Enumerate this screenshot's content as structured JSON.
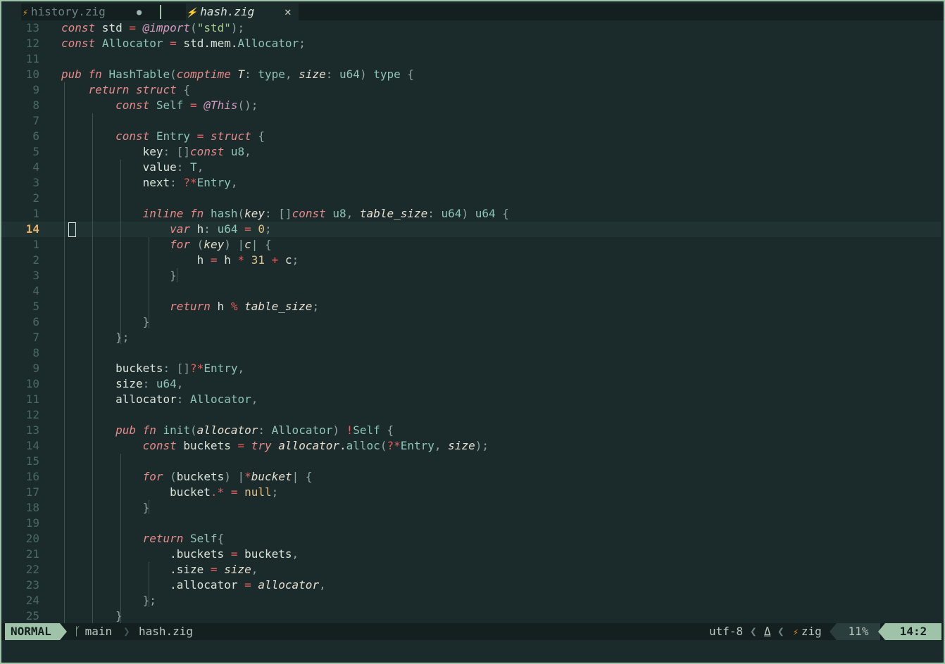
{
  "tabs": [
    {
      "name": "history.zig",
      "modified_indicator": "●",
      "icon": "zig-icon"
    },
    {
      "name": "hash.zig",
      "close_glyph": "✕",
      "icon": "zig-icon",
      "active": true
    }
  ],
  "editor": {
    "cursor_line": 14,
    "lines": [
      {
        "n": "13",
        "html": "<span class=\"kw\">const</span> std <span class=\"op\">=</span> <span class=\"bi\">@import</span><span class=\"pu\">(</span><span class=\"st\">\"std\"</span><span class=\"pu\">);</span>"
      },
      {
        "n": "12",
        "html": "<span class=\"kw\">const</span> <span class=\"ty\">Allocator</span> <span class=\"op\">=</span> std.mem.<span class=\"ty\">Allocator</span><span class=\"pu\">;</span>"
      },
      {
        "n": "11",
        "html": ""
      },
      {
        "n": "10",
        "html": "<span class=\"kw\">pub fn</span> <span class=\"ty\">HashTable</span><span class=\"pu\">(</span><span class=\"kw\">comptime</span> <span class=\"it\">T</span><span class=\"pu\">:</span> <span class=\"ty\">type</span><span class=\"pu\">,</span> <span class=\"it\">size</span><span class=\"pu\">:</span> <span class=\"ty\">u64</span><span class=\"pu\">)</span> <span class=\"ty\">type</span> <span class=\"pu\">{</span>"
      },
      {
        "n": "9",
        "html": "    <span class=\"kw\">return struct</span> <span class=\"pu\">{</span>"
      },
      {
        "n": "8",
        "html": "        <span class=\"kw\">const</span> <span class=\"ty\">Self</span> <span class=\"op\">=</span> <span class=\"bi\">@This</span><span class=\"pu\">();</span>"
      },
      {
        "n": "7",
        "html": ""
      },
      {
        "n": "6",
        "html": "        <span class=\"kw\">const</span> <span class=\"ty\">Entry</span> <span class=\"op\">=</span> <span class=\"kw\">struct</span> <span class=\"pu\">{</span>"
      },
      {
        "n": "5",
        "html": "            key<span class=\"pu\">:</span> <span class=\"pu\">[]</span><span class=\"kw\">const</span> <span class=\"ty\">u8</span><span class=\"pu\">,</span>"
      },
      {
        "n": "4",
        "html": "            value<span class=\"pu\">:</span> <span class=\"ty\">T</span><span class=\"pu\">,</span>"
      },
      {
        "n": "3",
        "html": "            next<span class=\"pu\">:</span> <span class=\"op\">?*</span><span class=\"ty\">Entry</span><span class=\"pu\">,</span>"
      },
      {
        "n": "2",
        "html": ""
      },
      {
        "n": "1",
        "html": "            <span class=\"kw\">inline fn</span> <span class=\"ty\">hash</span><span class=\"pu\">(</span><span class=\"it\">key</span><span class=\"pu\">:</span> <span class=\"pu\">[]</span><span class=\"kw\">const</span> <span class=\"ty\">u8</span><span class=\"pu\">,</span> <span class=\"it\">table_size</span><span class=\"pu\">:</span> <span class=\"ty\">u64</span><span class=\"pu\">)</span> <span class=\"ty\">u64</span> <span class=\"pu\">{</span>"
      },
      {
        "n": "14",
        "html": "                <span class=\"kw\">var</span> h<span class=\"pu\">:</span> <span class=\"ty\">u64</span> <span class=\"op\">=</span> <span class=\"nu\">0</span><span class=\"pu\">;</span>",
        "current": true
      },
      {
        "n": "1",
        "html": "                <span class=\"kw\">for</span> <span class=\"pu\">(</span><span class=\"it\">key</span><span class=\"pu\">)</span> <span class=\"pu\">|</span><span class=\"it\">c</span><span class=\"pu\">|</span> <span class=\"pu\">{</span>"
      },
      {
        "n": "2",
        "html": "                    h <span class=\"op\">=</span> h <span class=\"op\">*</span> <span class=\"nu\">31</span> <span class=\"op\">+</span> c<span class=\"pu\">;</span>"
      },
      {
        "n": "3",
        "html": "                <span class=\"pu\">}</span>"
      },
      {
        "n": "4",
        "html": ""
      },
      {
        "n": "5",
        "html": "                <span class=\"kw\">return</span> h <span class=\"op\">%</span> <span class=\"it\">table_size</span><span class=\"pu\">;</span>"
      },
      {
        "n": "6",
        "html": "            <span class=\"pu\">}</span>"
      },
      {
        "n": "7",
        "html": "        <span class=\"pu\">};</span>"
      },
      {
        "n": "8",
        "html": ""
      },
      {
        "n": "9",
        "html": "        buckets<span class=\"pu\">:</span> <span class=\"pu\">[]</span><span class=\"op\">?*</span><span class=\"ty\">Entry</span><span class=\"pu\">,</span>"
      },
      {
        "n": "10",
        "html": "        size<span class=\"pu\">:</span> <span class=\"ty\">u64</span><span class=\"pu\">,</span>"
      },
      {
        "n": "11",
        "html": "        allocator<span class=\"pu\">:</span> <span class=\"ty\">Allocator</span><span class=\"pu\">,</span>"
      },
      {
        "n": "12",
        "html": ""
      },
      {
        "n": "13",
        "html": "        <span class=\"kw\">pub fn</span> <span class=\"ty\">init</span><span class=\"pu\">(</span><span class=\"it\">allocator</span><span class=\"pu\">:</span> <span class=\"ty\">Allocator</span><span class=\"pu\">)</span> <span class=\"op\">!</span><span class=\"ty\">Self</span> <span class=\"pu\">{</span>"
      },
      {
        "n": "14",
        "html": "            <span class=\"kw\">const</span> buckets <span class=\"op\">=</span> <span class=\"kw\">try</span> <span class=\"it\">allocator</span>.<span class=\"ty\">alloc</span><span class=\"pu\">(</span><span class=\"op\">?*</span><span class=\"ty\">Entry</span><span class=\"pu\">,</span> <span class=\"it\">size</span><span class=\"pu\">);</span>"
      },
      {
        "n": "15",
        "html": ""
      },
      {
        "n": "16",
        "html": "            <span class=\"kw\">for</span> <span class=\"pu\">(</span>buckets<span class=\"pu\">)</span> <span class=\"pu\">|</span><span class=\"op\">*</span><span class=\"it\">bucket</span><span class=\"pu\">|</span> <span class=\"pu\">{</span>"
      },
      {
        "n": "17",
        "html": "                bucket<span class=\"op\">.*</span> <span class=\"op\">=</span> <span class=\"nu\">null</span><span class=\"pu\">;</span>"
      },
      {
        "n": "18",
        "html": "            <span class=\"pu\">}</span>"
      },
      {
        "n": "19",
        "html": ""
      },
      {
        "n": "20",
        "html": "            <span class=\"kw\">return</span> <span class=\"ty\">Self</span><span class=\"pu\">{</span>"
      },
      {
        "n": "21",
        "html": "                .buckets <span class=\"op\">=</span> buckets<span class=\"pu\">,</span>"
      },
      {
        "n": "22",
        "html": "                .size <span class=\"op\">=</span> <span class=\"it\">size</span><span class=\"pu\">,</span>"
      },
      {
        "n": "23",
        "html": "                .allocator <span class=\"op\">=</span> <span class=\"it\">allocator</span><span class=\"pu\">,</span>"
      },
      {
        "n": "24",
        "html": "            <span class=\"pu\">};</span>"
      },
      {
        "n": "25",
        "html": "        <span class=\"pu\">}</span>"
      }
    ]
  },
  "statusline": {
    "mode": "NORMAL",
    "branch_icon": "git-branch-icon",
    "branch": "main",
    "file": "hash.zig",
    "encoding": "utf-8",
    "git_icon": "git-icon",
    "git_glyph": "⍙",
    "language": "zig",
    "percent": "11%",
    "position": "14:2"
  }
}
